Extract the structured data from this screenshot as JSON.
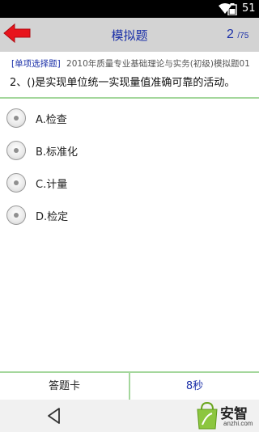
{
  "status_bar": {
    "battery_level": "51"
  },
  "header": {
    "title": "模拟题",
    "current_question": "2",
    "total_questions": "/75",
    "back_icon": "red-left-arrow-icon"
  },
  "question": {
    "type_label": "[单项选择题]",
    "source": "2010年质量专业基础理论与实务(初级)模拟题01",
    "text": "2、()是实现单位统一实现量值准确可靠的活动。"
  },
  "options": [
    {
      "label": "A.检查"
    },
    {
      "label": "B.标准化"
    },
    {
      "label": "C.计量"
    },
    {
      "label": "D.检定"
    }
  ],
  "bottom_bar": {
    "answer_card_label": "答题卡",
    "timer": "8秒"
  },
  "watermark": {
    "name": "安智",
    "url": "anzhi.com"
  },
  "colors": {
    "accent": "#1a2fa8",
    "divider": "#a4d79c",
    "header_bg": "#d3d3d3",
    "back_arrow": "#e8141c"
  }
}
